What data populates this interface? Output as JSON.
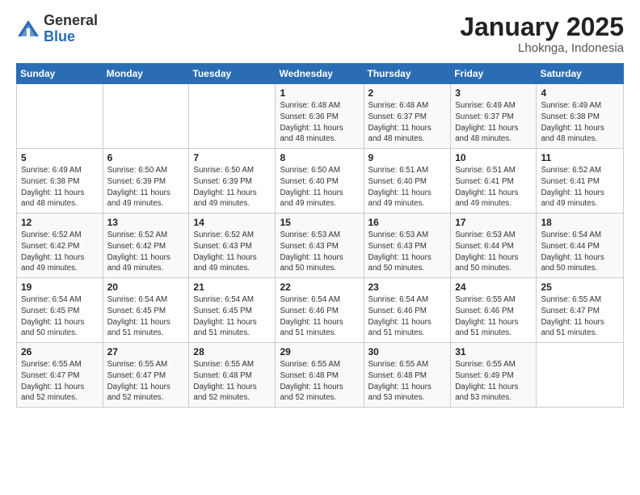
{
  "logo": {
    "general": "General",
    "blue": "Blue"
  },
  "title": "January 2025",
  "location": "Lhoknga, Indonesia",
  "days_header": [
    "Sunday",
    "Monday",
    "Tuesday",
    "Wednesday",
    "Thursday",
    "Friday",
    "Saturday"
  ],
  "weeks": [
    [
      {
        "day": "",
        "info": ""
      },
      {
        "day": "",
        "info": ""
      },
      {
        "day": "",
        "info": ""
      },
      {
        "day": "1",
        "info": "Sunrise: 6:48 AM\nSunset: 6:36 PM\nDaylight: 11 hours\nand 48 minutes."
      },
      {
        "day": "2",
        "info": "Sunrise: 6:48 AM\nSunset: 6:37 PM\nDaylight: 11 hours\nand 48 minutes."
      },
      {
        "day": "3",
        "info": "Sunrise: 6:49 AM\nSunset: 6:37 PM\nDaylight: 11 hours\nand 48 minutes."
      },
      {
        "day": "4",
        "info": "Sunrise: 6:49 AM\nSunset: 6:38 PM\nDaylight: 11 hours\nand 48 minutes."
      }
    ],
    [
      {
        "day": "5",
        "info": "Sunrise: 6:49 AM\nSunset: 6:38 PM\nDaylight: 11 hours\nand 48 minutes."
      },
      {
        "day": "6",
        "info": "Sunrise: 6:50 AM\nSunset: 6:39 PM\nDaylight: 11 hours\nand 49 minutes."
      },
      {
        "day": "7",
        "info": "Sunrise: 6:50 AM\nSunset: 6:39 PM\nDaylight: 11 hours\nand 49 minutes."
      },
      {
        "day": "8",
        "info": "Sunrise: 6:50 AM\nSunset: 6:40 PM\nDaylight: 11 hours\nand 49 minutes."
      },
      {
        "day": "9",
        "info": "Sunrise: 6:51 AM\nSunset: 6:40 PM\nDaylight: 11 hours\nand 49 minutes."
      },
      {
        "day": "10",
        "info": "Sunrise: 6:51 AM\nSunset: 6:41 PM\nDaylight: 11 hours\nand 49 minutes."
      },
      {
        "day": "11",
        "info": "Sunrise: 6:52 AM\nSunset: 6:41 PM\nDaylight: 11 hours\nand 49 minutes."
      }
    ],
    [
      {
        "day": "12",
        "info": "Sunrise: 6:52 AM\nSunset: 6:42 PM\nDaylight: 11 hours\nand 49 minutes."
      },
      {
        "day": "13",
        "info": "Sunrise: 6:52 AM\nSunset: 6:42 PM\nDaylight: 11 hours\nand 49 minutes."
      },
      {
        "day": "14",
        "info": "Sunrise: 6:52 AM\nSunset: 6:43 PM\nDaylight: 11 hours\nand 49 minutes."
      },
      {
        "day": "15",
        "info": "Sunrise: 6:53 AM\nSunset: 6:43 PM\nDaylight: 11 hours\nand 50 minutes."
      },
      {
        "day": "16",
        "info": "Sunrise: 6:53 AM\nSunset: 6:43 PM\nDaylight: 11 hours\nand 50 minutes."
      },
      {
        "day": "17",
        "info": "Sunrise: 6:53 AM\nSunset: 6:44 PM\nDaylight: 11 hours\nand 50 minutes."
      },
      {
        "day": "18",
        "info": "Sunrise: 6:54 AM\nSunset: 6:44 PM\nDaylight: 11 hours\nand 50 minutes."
      }
    ],
    [
      {
        "day": "19",
        "info": "Sunrise: 6:54 AM\nSunset: 6:45 PM\nDaylight: 11 hours\nand 50 minutes."
      },
      {
        "day": "20",
        "info": "Sunrise: 6:54 AM\nSunset: 6:45 PM\nDaylight: 11 hours\nand 51 minutes."
      },
      {
        "day": "21",
        "info": "Sunrise: 6:54 AM\nSunset: 6:45 PM\nDaylight: 11 hours\nand 51 minutes."
      },
      {
        "day": "22",
        "info": "Sunrise: 6:54 AM\nSunset: 6:46 PM\nDaylight: 11 hours\nand 51 minutes."
      },
      {
        "day": "23",
        "info": "Sunrise: 6:54 AM\nSunset: 6:46 PM\nDaylight: 11 hours\nand 51 minutes."
      },
      {
        "day": "24",
        "info": "Sunrise: 6:55 AM\nSunset: 6:46 PM\nDaylight: 11 hours\nand 51 minutes."
      },
      {
        "day": "25",
        "info": "Sunrise: 6:55 AM\nSunset: 6:47 PM\nDaylight: 11 hours\nand 51 minutes."
      }
    ],
    [
      {
        "day": "26",
        "info": "Sunrise: 6:55 AM\nSunset: 6:47 PM\nDaylight: 11 hours\nand 52 minutes."
      },
      {
        "day": "27",
        "info": "Sunrise: 6:55 AM\nSunset: 6:47 PM\nDaylight: 11 hours\nand 52 minutes."
      },
      {
        "day": "28",
        "info": "Sunrise: 6:55 AM\nSunset: 6:48 PM\nDaylight: 11 hours\nand 52 minutes."
      },
      {
        "day": "29",
        "info": "Sunrise: 6:55 AM\nSunset: 6:48 PM\nDaylight: 11 hours\nand 52 minutes."
      },
      {
        "day": "30",
        "info": "Sunrise: 6:55 AM\nSunset: 6:48 PM\nDaylight: 11 hours\nand 53 minutes."
      },
      {
        "day": "31",
        "info": "Sunrise: 6:55 AM\nSunset: 6:49 PM\nDaylight: 11 hours\nand 53 minutes."
      },
      {
        "day": "",
        "info": ""
      }
    ]
  ]
}
